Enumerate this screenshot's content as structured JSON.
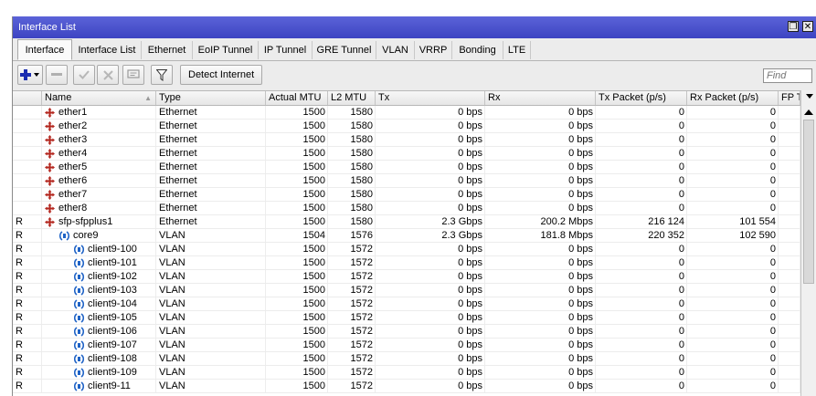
{
  "window": {
    "title": "Interface List",
    "restore_glyph": "❐",
    "close_glyph": "✕"
  },
  "tabs": [
    {
      "label": "Interface",
      "active": true
    },
    {
      "label": "Interface List",
      "active": false
    },
    {
      "label": "Ethernet",
      "active": false
    },
    {
      "label": "EoIP Tunnel",
      "active": false
    },
    {
      "label": "IP Tunnel",
      "active": false
    },
    {
      "label": "GRE Tunnel",
      "active": false
    },
    {
      "label": "VLAN",
      "active": false
    },
    {
      "label": "VRRP",
      "active": false
    },
    {
      "label": "Bonding",
      "active": false
    },
    {
      "label": "LTE",
      "active": false
    }
  ],
  "toolbar": {
    "add_icon": "plus-dropdown-icon",
    "remove_icon": "minus-icon",
    "enable_icon": "check-icon",
    "disable_icon": "cross-icon",
    "comment_icon": "comment-icon",
    "filter_icon": "filter-icon",
    "detect_label": "Detect Internet",
    "find_placeholder": "Find",
    "accent_color": "#1b2db0"
  },
  "table": {
    "columns": [
      "",
      "Name",
      "Type",
      "Actual MTU",
      "L2 MTU",
      "Tx",
      "Rx",
      "Tx Packet (p/s)",
      "Rx Packet (p/s)",
      "FP T"
    ],
    "rows": [
      {
        "flag": "",
        "name": "ether1",
        "type": "Ethernet",
        "mtu": "1500",
        "l2mtu": "1580",
        "tx": "0 bps",
        "rx": "0 bps",
        "txp": "0",
        "rxp": "0",
        "kind": "ether",
        "indent": 0
      },
      {
        "flag": "",
        "name": "ether2",
        "type": "Ethernet",
        "mtu": "1500",
        "l2mtu": "1580",
        "tx": "0 bps",
        "rx": "0 bps",
        "txp": "0",
        "rxp": "0",
        "kind": "ether",
        "indent": 0
      },
      {
        "flag": "",
        "name": "ether3",
        "type": "Ethernet",
        "mtu": "1500",
        "l2mtu": "1580",
        "tx": "0 bps",
        "rx": "0 bps",
        "txp": "0",
        "rxp": "0",
        "kind": "ether",
        "indent": 0
      },
      {
        "flag": "",
        "name": "ether4",
        "type": "Ethernet",
        "mtu": "1500",
        "l2mtu": "1580",
        "tx": "0 bps",
        "rx": "0 bps",
        "txp": "0",
        "rxp": "0",
        "kind": "ether",
        "indent": 0
      },
      {
        "flag": "",
        "name": "ether5",
        "type": "Ethernet",
        "mtu": "1500",
        "l2mtu": "1580",
        "tx": "0 bps",
        "rx": "0 bps",
        "txp": "0",
        "rxp": "0",
        "kind": "ether",
        "indent": 0
      },
      {
        "flag": "",
        "name": "ether6",
        "type": "Ethernet",
        "mtu": "1500",
        "l2mtu": "1580",
        "tx": "0 bps",
        "rx": "0 bps",
        "txp": "0",
        "rxp": "0",
        "kind": "ether",
        "indent": 0
      },
      {
        "flag": "",
        "name": "ether7",
        "type": "Ethernet",
        "mtu": "1500",
        "l2mtu": "1580",
        "tx": "0 bps",
        "rx": "0 bps",
        "txp": "0",
        "rxp": "0",
        "kind": "ether",
        "indent": 0
      },
      {
        "flag": "",
        "name": "ether8",
        "type": "Ethernet",
        "mtu": "1500",
        "l2mtu": "1580",
        "tx": "0 bps",
        "rx": "0 bps",
        "txp": "0",
        "rxp": "0",
        "kind": "ether",
        "indent": 0
      },
      {
        "flag": "R",
        "name": "sfp-sfpplus1",
        "type": "Ethernet",
        "mtu": "1500",
        "l2mtu": "1580",
        "tx": "2.3 Gbps",
        "rx": "200.2 Mbps",
        "txp": "216 124",
        "rxp": "101 554",
        "kind": "ether",
        "indent": 0
      },
      {
        "flag": "R",
        "name": "core9",
        "type": "VLAN",
        "mtu": "1504",
        "l2mtu": "1576",
        "tx": "2.3 Gbps",
        "rx": "181.8 Mbps",
        "txp": "220 352",
        "rxp": "102 590",
        "kind": "vlan",
        "indent": 1
      },
      {
        "flag": "R",
        "name": "client9-100",
        "type": "VLAN",
        "mtu": "1500",
        "l2mtu": "1572",
        "tx": "0 bps",
        "rx": "0 bps",
        "txp": "0",
        "rxp": "0",
        "kind": "vlan",
        "indent": 2
      },
      {
        "flag": "R",
        "name": "client9-101",
        "type": "VLAN",
        "mtu": "1500",
        "l2mtu": "1572",
        "tx": "0 bps",
        "rx": "0 bps",
        "txp": "0",
        "rxp": "0",
        "kind": "vlan",
        "indent": 2
      },
      {
        "flag": "R",
        "name": "client9-102",
        "type": "VLAN",
        "mtu": "1500",
        "l2mtu": "1572",
        "tx": "0 bps",
        "rx": "0 bps",
        "txp": "0",
        "rxp": "0",
        "kind": "vlan",
        "indent": 2
      },
      {
        "flag": "R",
        "name": "client9-103",
        "type": "VLAN",
        "mtu": "1500",
        "l2mtu": "1572",
        "tx": "0 bps",
        "rx": "0 bps",
        "txp": "0",
        "rxp": "0",
        "kind": "vlan",
        "indent": 2
      },
      {
        "flag": "R",
        "name": "client9-104",
        "type": "VLAN",
        "mtu": "1500",
        "l2mtu": "1572",
        "tx": "0 bps",
        "rx": "0 bps",
        "txp": "0",
        "rxp": "0",
        "kind": "vlan",
        "indent": 2
      },
      {
        "flag": "R",
        "name": "client9-105",
        "type": "VLAN",
        "mtu": "1500",
        "l2mtu": "1572",
        "tx": "0 bps",
        "rx": "0 bps",
        "txp": "0",
        "rxp": "0",
        "kind": "vlan",
        "indent": 2
      },
      {
        "flag": "R",
        "name": "client9-106",
        "type": "VLAN",
        "mtu": "1500",
        "l2mtu": "1572",
        "tx": "0 bps",
        "rx": "0 bps",
        "txp": "0",
        "rxp": "0",
        "kind": "vlan",
        "indent": 2
      },
      {
        "flag": "R",
        "name": "client9-107",
        "type": "VLAN",
        "mtu": "1500",
        "l2mtu": "1572",
        "tx": "0 bps",
        "rx": "0 bps",
        "txp": "0",
        "rxp": "0",
        "kind": "vlan",
        "indent": 2
      },
      {
        "flag": "R",
        "name": "client9-108",
        "type": "VLAN",
        "mtu": "1500",
        "l2mtu": "1572",
        "tx": "0 bps",
        "rx": "0 bps",
        "txp": "0",
        "rxp": "0",
        "kind": "vlan",
        "indent": 2
      },
      {
        "flag": "R",
        "name": "client9-109",
        "type": "VLAN",
        "mtu": "1500",
        "l2mtu": "1572",
        "tx": "0 bps",
        "rx": "0 bps",
        "txp": "0",
        "rxp": "0",
        "kind": "vlan",
        "indent": 2
      },
      {
        "flag": "R",
        "name": "client9-11",
        "type": "VLAN",
        "mtu": "1500",
        "l2mtu": "1572",
        "tx": "0 bps",
        "rx": "0 bps",
        "txp": "0",
        "rxp": "0",
        "kind": "vlan",
        "indent": 2
      }
    ]
  },
  "colors": {
    "title_bar": "#4a52d0",
    "ether_icon": "#b3261e",
    "vlan_icon": "#1f63c6"
  }
}
